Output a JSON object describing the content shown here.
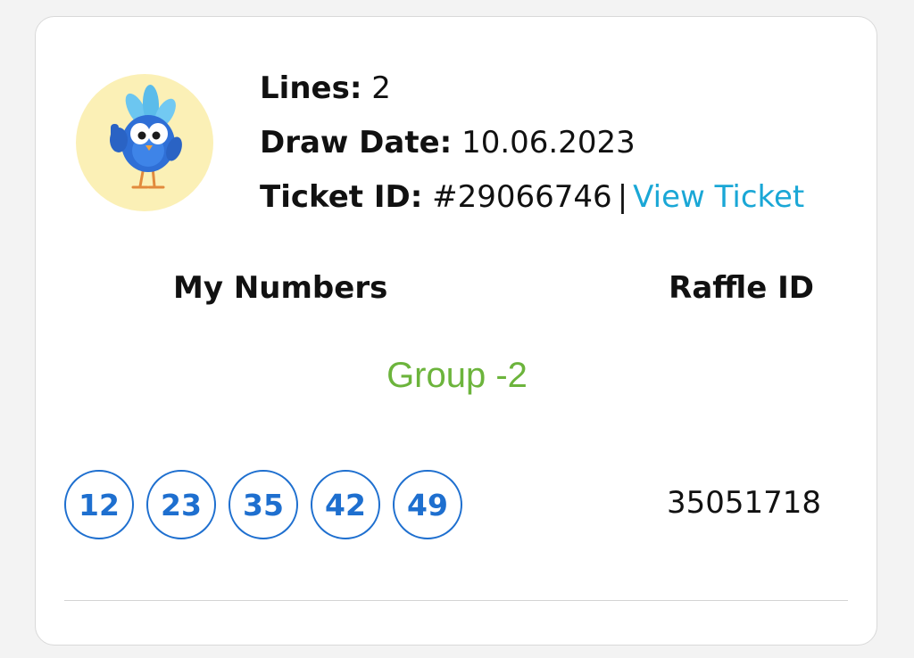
{
  "ticket": {
    "lines_label": "Lines:",
    "lines_value": "2",
    "draw_date_label": "Draw Date:",
    "draw_date_value": "10.06.2023",
    "ticket_id_label": "Ticket ID:",
    "ticket_id_value": "#29066746",
    "separator": "|",
    "view_ticket_label": "View Ticket"
  },
  "headers": {
    "my_numbers": "My Numbers",
    "raffle_id": "Raffle ID"
  },
  "group_label": "Group -2",
  "numbers": [
    "12",
    "23",
    "35",
    "42",
    "49"
  ],
  "raffle_id_value": "35051718",
  "avatar_icon": "mascot-bird-thumbs-up-icon",
  "colors": {
    "link": "#1aa7d6",
    "ball": "#1e6fcf",
    "group": "#6cb43c",
    "avatar_bg": "#fbf0b6"
  }
}
